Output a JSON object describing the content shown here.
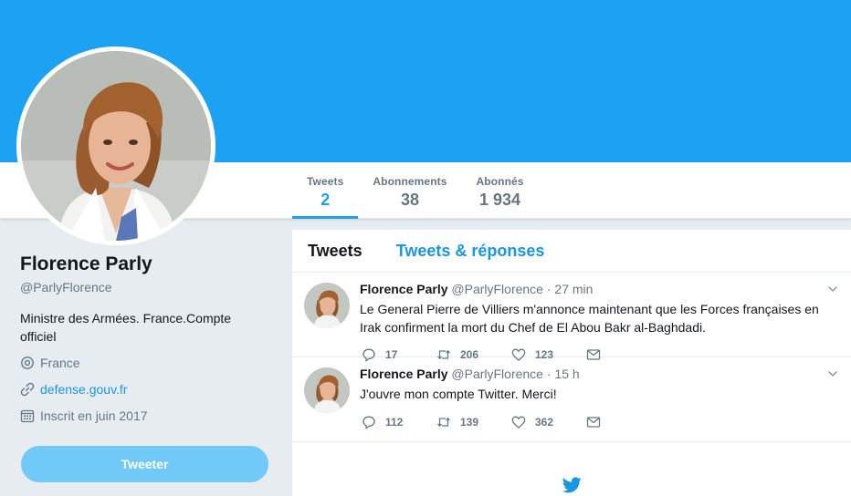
{
  "colors": {
    "banner": "#1da1f2",
    "accent": "#1da1f2",
    "link": "#1b95e0",
    "tweet_button": "#71c9f8"
  },
  "profile": {
    "name": "Florence Parly",
    "handle": "@ParlyFlorence",
    "bio": "Ministre des Armées. France.Compte officiel",
    "location": "France",
    "website": "defense.gouv.fr",
    "joined": "Inscrit en juin 2017",
    "tweet_button": "Tweeter"
  },
  "stats": [
    {
      "label": "Tweets",
      "value": "2"
    },
    {
      "label": "Abonnements",
      "value": "38"
    },
    {
      "label": "Abonnés",
      "value": "1 934"
    }
  ],
  "timeline": {
    "tabs": [
      "Tweets",
      "Tweets & réponses"
    ],
    "tweets": [
      {
        "name": "Florence Parly",
        "handle": "@ParlyFlorence",
        "time": "· 27 min",
        "text": "Le General Pierre de Villiers m'annonce maintenant que les Forces françaises en Irak confirment la mort du Chef de El Abou Bakr al-Baghdadi.",
        "replies": "17",
        "retweets": "206",
        "likes": "123"
      },
      {
        "name": "Florence Parly",
        "handle": "@ParlyFlorence",
        "time": "· 15 h",
        "text": "J'ouvre mon compte Twitter. Merci!",
        "replies": "112",
        "retweets": "139",
        "likes": "362"
      }
    ]
  },
  "icons": [
    "location-icon",
    "link-icon",
    "calendar-icon",
    "reply-icon",
    "retweet-icon",
    "like-icon",
    "message-icon",
    "caret-down-icon",
    "twitter-bird-icon"
  ]
}
